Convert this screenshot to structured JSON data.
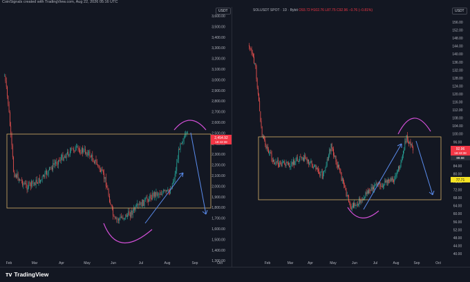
{
  "header": {
    "credit": "CoinSignals created with TradingView.com, Aug 22, 2026 05:16 UTC"
  },
  "left_chart": {
    "currency_button": "USDT",
    "price_axis": [
      "3,600.00",
      "3,500.00",
      "3,400.00",
      "3,300.00",
      "3,200.00",
      "3,100.00",
      "3,000.00",
      "2,900.00",
      "2,800.00",
      "2,700.00",
      "2,600.00",
      "2,500.00",
      "2,400.00",
      "2,300.00",
      "2,200.00",
      "2,100.00",
      "2,000.00",
      "1,900.00",
      "1,800.00",
      "1,700.00",
      "1,600.00",
      "1,500.00",
      "1,400.00",
      "1,300.00"
    ],
    "time_axis": [
      "Feb",
      "Mar",
      "Apr",
      "May",
      "Jun",
      "Jul",
      "Aug",
      "Sep",
      "Oct"
    ],
    "last_price_label": "2,454.92",
    "countdown_label": "18:43:38"
  },
  "right_chart": {
    "currency_button": "USDT",
    "legend": {
      "symbol": "SOLUSDT SPOT · 1D · Bybit",
      "open": "O93.72",
      "high": "H102.76",
      "low": "L87.75",
      "close": "C92.96",
      "change": "−0.76 (−0.81%)"
    },
    "price_axis": [
      "156.00",
      "152.00",
      "148.00",
      "144.00",
      "140.00",
      "136.00",
      "132.00",
      "128.00",
      "124.00",
      "120.00",
      "116.00",
      "112.00",
      "108.00",
      "104.00",
      "100.00",
      "96.00",
      "92.00",
      "88.00",
      "84.00",
      "80.00",
      "76.00",
      "72.00",
      "68.00",
      "64.00",
      "60.00",
      "56.00",
      "52.00",
      "48.00",
      "44.00",
      "40.00"
    ],
    "time_axis": [
      "Feb",
      "Mar",
      "Apr",
      "May",
      "Jun",
      "Jul",
      "Aug",
      "Sep",
      "Oct"
    ],
    "last_price_label": "92.96",
    "countdown_label": "18:43:38",
    "extra_label": "89.58",
    "yellow_label": "77.71"
  },
  "footer": {
    "brand": "TradingView",
    "logo_icon": "tradingview-logo-icon"
  },
  "colors": {
    "up": "#26a69a",
    "down": "#ef5350",
    "box": "#d8b26a",
    "arrow": "#5b8def",
    "arc": "#d14fd6",
    "axis_text": "#b2b5be"
  }
}
